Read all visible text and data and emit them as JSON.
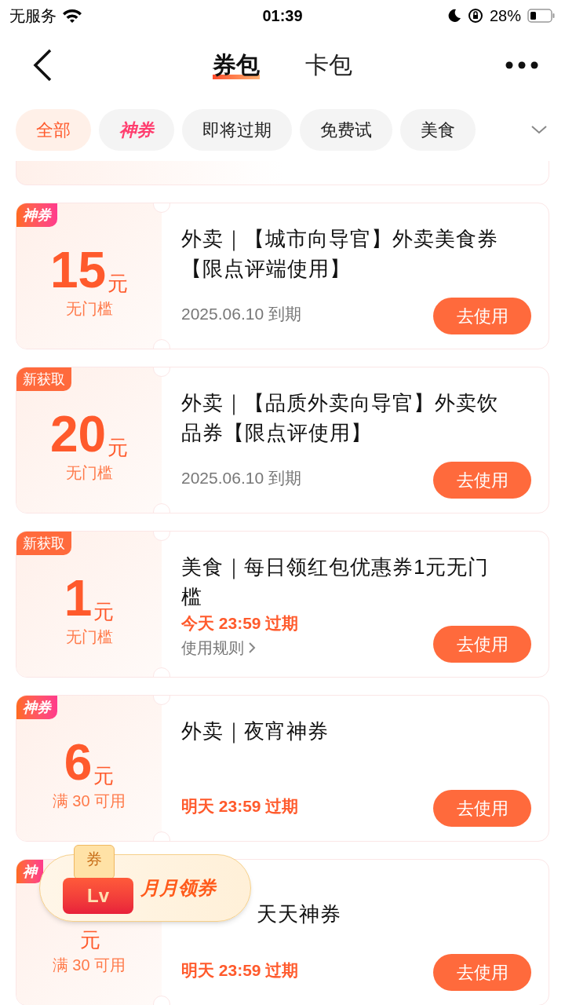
{
  "status_bar": {
    "carrier": "无服务",
    "time": "01:39",
    "battery": "28%"
  },
  "header": {
    "tabs": [
      {
        "label": "券包",
        "selected": true
      },
      {
        "label": "卡包",
        "selected": false
      }
    ]
  },
  "filters": [
    {
      "label": "全部",
      "selected": true,
      "kind": "plain"
    },
    {
      "label": "神券",
      "selected": false,
      "kind": "brand"
    },
    {
      "label": "即将过期",
      "selected": false,
      "kind": "plain"
    },
    {
      "label": "免费试",
      "selected": false,
      "kind": "plain"
    },
    {
      "label": "美食",
      "selected": false,
      "kind": "plain"
    }
  ],
  "coupons": [
    {
      "badge": {
        "text": "神券",
        "kind": "shen"
      },
      "amount": "15",
      "unit": "元",
      "condition": "无门槛",
      "title": "外卖｜【城市向导官】外卖美食券【限点评端使用】",
      "expiry": "2025.06.10 到期",
      "urgent": false,
      "button": "去使用",
      "obscured": false
    },
    {
      "badge": {
        "text": "新获取",
        "kind": "new"
      },
      "amount": "20",
      "unit": "元",
      "condition": "无门槛",
      "title": "外卖｜【品质外卖向导官】外卖饮品券【限点评使用】",
      "expiry": "2025.06.10 到期",
      "urgent": false,
      "button": "去使用",
      "obscured": false
    },
    {
      "badge": {
        "text": "新获取",
        "kind": "new"
      },
      "amount": "1",
      "unit": "元",
      "condition": "无门槛",
      "title": "美食｜每日领红包优惠券1元无门槛",
      "expiry": "今天 23:59 过期",
      "urgent": true,
      "rules": "使用规则",
      "button": "去使用",
      "obscured": false
    },
    {
      "badge": {
        "text": "神券",
        "kind": "shen"
      },
      "amount": "6",
      "unit": "元",
      "condition": "满 30 可用",
      "title": "外卖｜夜宵神券",
      "expiry": "明天 23:59 过期",
      "urgent": true,
      "button": "去使用",
      "obscured": false
    },
    {
      "badge": {
        "text": "神",
        "kind": "shen"
      },
      "unit": "元",
      "condition": "满 30 可用",
      "title": "天天神券",
      "expiry": "明天 23:59 过期",
      "urgent": true,
      "button": "去使用",
      "obscured": true
    }
  ],
  "floating_promo": {
    "icon_text": "券",
    "icon_label": "Lv",
    "label": "月月领券"
  }
}
